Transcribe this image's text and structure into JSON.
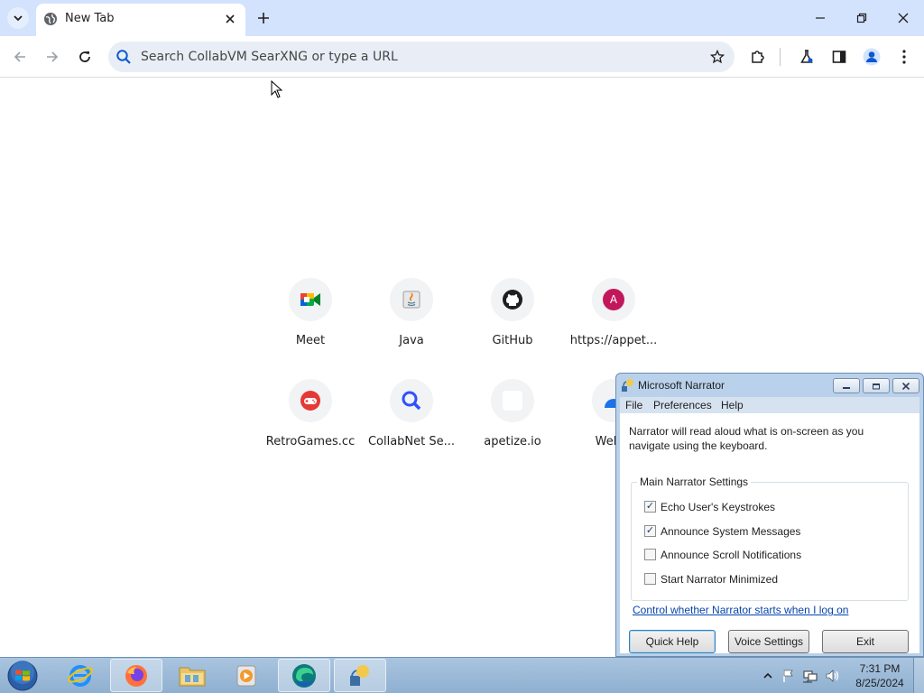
{
  "browser": {
    "tab": {
      "title": "New Tab"
    },
    "omnibox": {
      "placeholder": "Search CollabVM SearXNG or type a URL"
    }
  },
  "shortcuts": [
    {
      "label": "Meet",
      "icon": "google-meet-icon"
    },
    {
      "label": "Java",
      "icon": "java-icon"
    },
    {
      "label": "GitHub",
      "icon": "github-icon"
    },
    {
      "label": "https://appet...",
      "icon": "letter-a-icon",
      "letter": "A"
    },
    {
      "label": "RetroGames.cc",
      "icon": "gamepad-icon"
    },
    {
      "label": "CollabNet Se...",
      "icon": "search-icon"
    },
    {
      "label": "apetize.io",
      "icon": "blank-icon"
    },
    {
      "label": "Web S",
      "icon": "web-icon"
    }
  ],
  "narrator": {
    "title": "Microsoft Narrator",
    "menu": {
      "file": "File",
      "preferences": "Preferences",
      "help": "Help"
    },
    "description": "Narrator will read aloud what is on-screen as you navigate using the keyboard.",
    "group_title": "Main Narrator Settings",
    "options": [
      {
        "label": "Echo User's Keystrokes",
        "checked": true
      },
      {
        "label": "Announce System Messages",
        "checked": true
      },
      {
        "label": "Announce Scroll Notifications",
        "checked": false
      },
      {
        "label": "Start Narrator Minimized",
        "checked": false
      }
    ],
    "link": "Control whether Narrator starts when I log on",
    "buttons": {
      "quick_help": "Quick Help",
      "voice_settings": "Voice Settings",
      "exit": "Exit"
    }
  },
  "taskbar": {
    "clock_time": "7:31 PM",
    "clock_date": "8/25/2024"
  },
  "colors": {
    "tabstrip": "#d3e3fd",
    "omnibox": "#e9eef6",
    "taskbar": "#a9c4df",
    "link": "#0645ad"
  }
}
